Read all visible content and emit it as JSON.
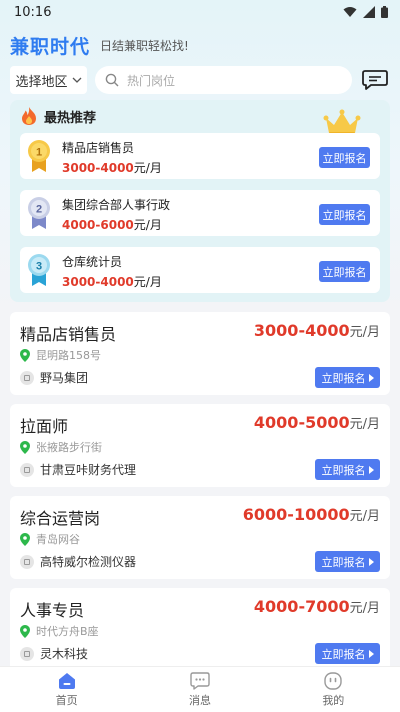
{
  "status_bar": {
    "time": "10:16"
  },
  "header": {
    "title": "兼职时代",
    "slogan": "日结兼职轻松找!"
  },
  "search": {
    "region": "选择地区",
    "placeholder": "热门岗位"
  },
  "hot": {
    "title": "最热推荐",
    "items": [
      {
        "rank": "1",
        "job": "精品店销售员",
        "salary": "3000-4000",
        "unit": "元/月",
        "apply": "立即报名"
      },
      {
        "rank": "2",
        "job": "集团综合部人事行政",
        "salary": "4000-6000",
        "unit": "元/月",
        "apply": "立即报名"
      },
      {
        "rank": "3",
        "job": "仓库统计员",
        "salary": "3000-4000",
        "unit": "元/月",
        "apply": "立即报名"
      }
    ]
  },
  "jobs": [
    {
      "title": "精品店销售员",
      "salary": "3000-4000",
      "unit": "元/月",
      "location": "昆明路158号",
      "company": "野马集团",
      "apply": "立即报名"
    },
    {
      "title": "拉面师",
      "salary": "4000-5000",
      "unit": "元/月",
      "location": "张掖路步行街",
      "company": "甘肃豆咔财务代理",
      "apply": "立即报名"
    },
    {
      "title": "综合运营岗",
      "salary": "6000-10000",
      "unit": "元/月",
      "location": "青岛网谷",
      "company": "高特威尔检测仪器",
      "apply": "立即报名"
    },
    {
      "title": "人事专员",
      "salary": "4000-7000",
      "unit": "元/月",
      "location": "时代方舟B座",
      "company": "灵木科技",
      "apply": "立即报名"
    }
  ],
  "tabs": [
    {
      "label": "首页",
      "active": true
    },
    {
      "label": "消息",
      "active": false
    },
    {
      "label": "我的",
      "active": false
    }
  ],
  "colors": {
    "accent": "#4f7af0",
    "brand": "#2f7cf0",
    "salary": "#e03a2a",
    "location_pin": "#2db84b"
  }
}
